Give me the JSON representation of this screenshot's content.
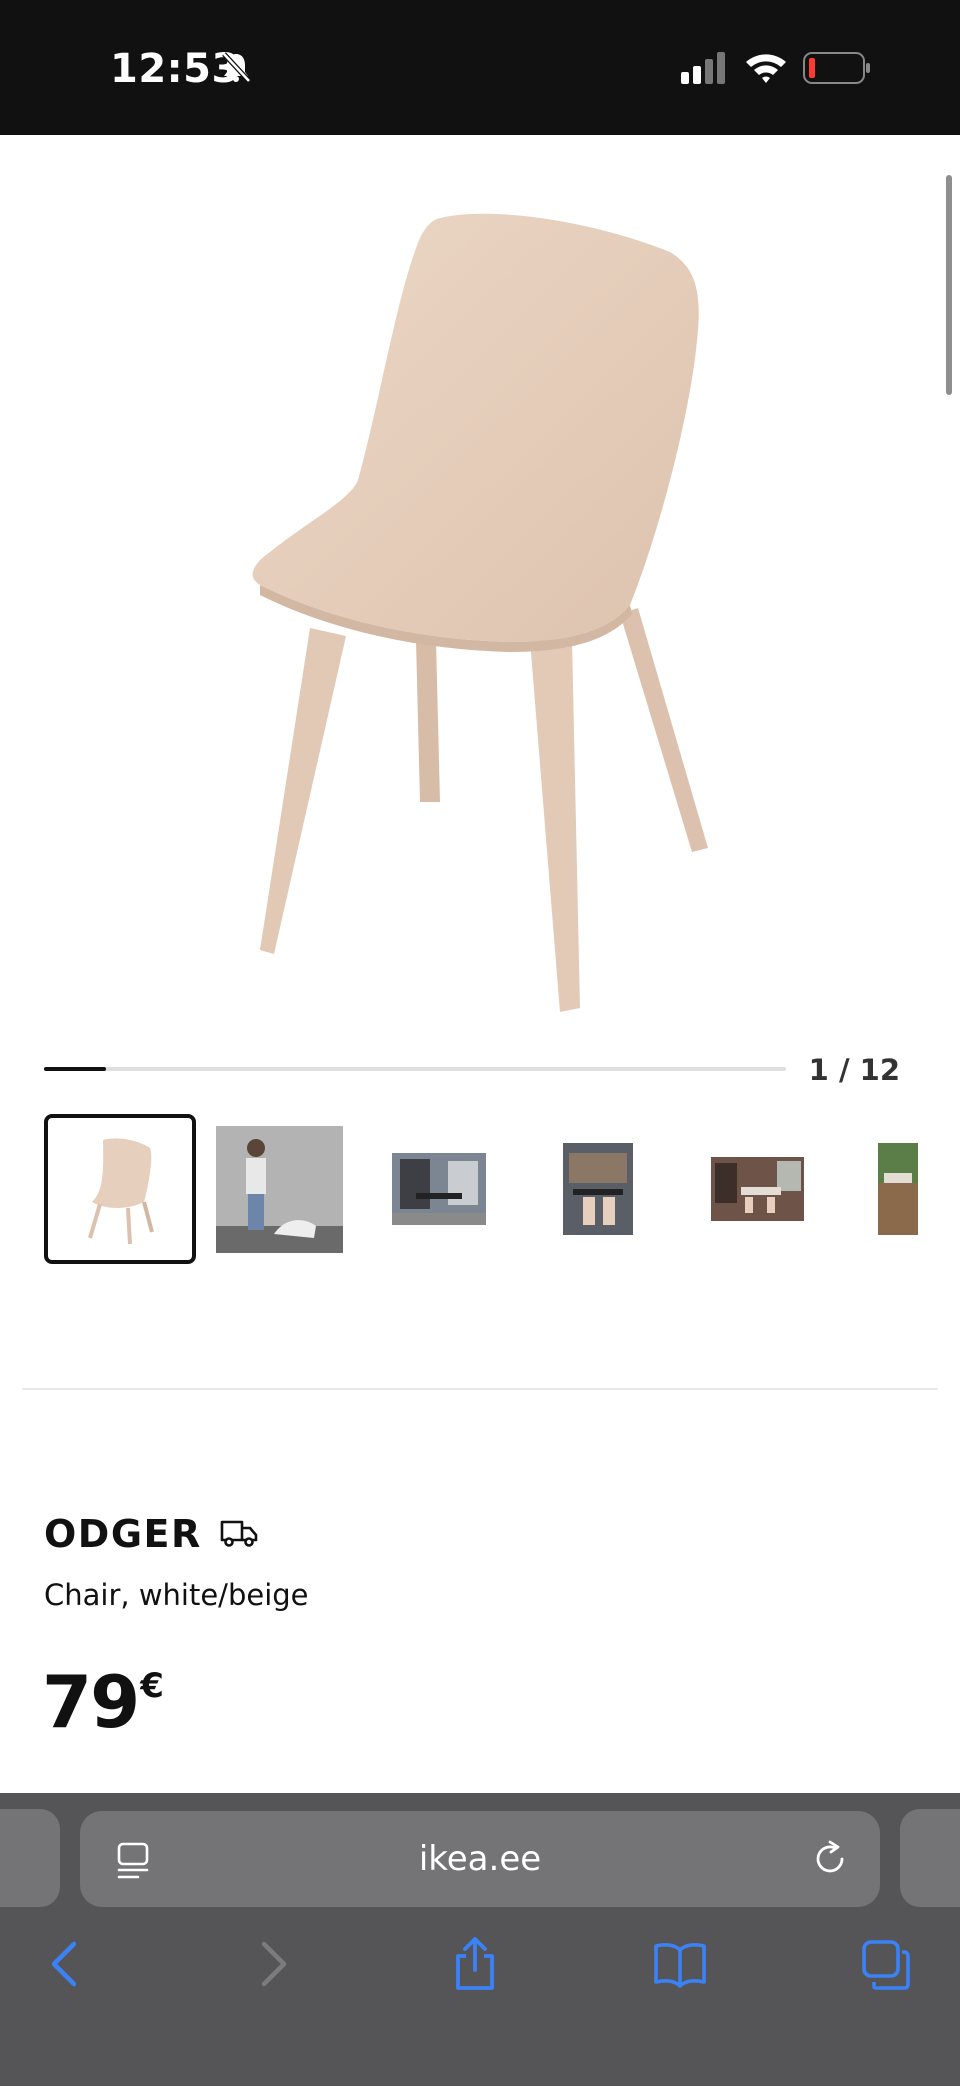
{
  "status_bar": {
    "time": "12:53"
  },
  "gallery": {
    "counter": "1 / 12",
    "progress_fraction": 0.083
  },
  "product": {
    "name": "ODGER",
    "description": "Chair, white/beige",
    "price": "79",
    "currency": "€"
  },
  "browser": {
    "url": "ikea.ee"
  },
  "colors": {
    "accent": "#3b82f6",
    "chair": "#e6cfbd",
    "battery_low": "#ff3b30"
  }
}
